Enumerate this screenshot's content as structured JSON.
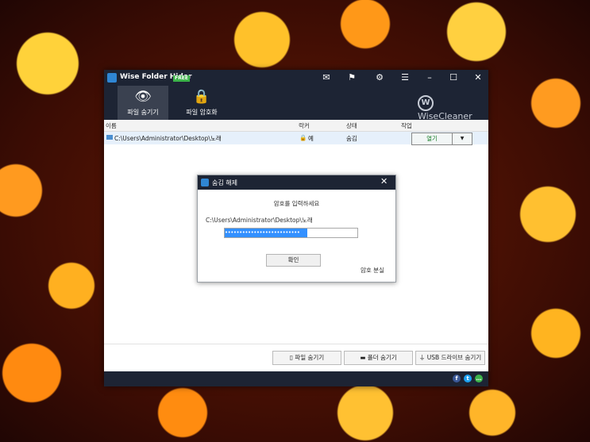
{
  "app": {
    "title": "Wise Folder Hider",
    "badge": "FREE",
    "brand": "WiseCleaner"
  },
  "titlebar_icons": [
    "mail-icon",
    "feedback-icon",
    "settings-icon",
    "menu-icon",
    "minimize-icon",
    "maximize-icon",
    "close-icon"
  ],
  "titlebar_glyphs": {
    "mail": "✉",
    "feedback": "⚑",
    "settings": "⚙",
    "menu": "☰",
    "minimize": "–",
    "maximize": "☐",
    "close": "✕"
  },
  "toolbar": {
    "tabs": [
      {
        "label": "파일 숨기기",
        "icon": "eye-icon",
        "glyph": "👁",
        "active": true
      },
      {
        "label": "파일 암호화",
        "icon": "lock-icon",
        "glyph": "🔒",
        "active": false
      }
    ]
  },
  "table": {
    "columns": [
      "이름",
      "락커",
      "상태",
      "작업"
    ],
    "rows": [
      {
        "name": "C:\\Users\\Administrator\\Desktop\\노래",
        "locker": "예",
        "status": "숨김",
        "action": "열기",
        "dropdown": "▼"
      }
    ]
  },
  "bottom_buttons": [
    "파일 숨기기",
    "폴더 숨기기",
    "USB 드라이브 숨기기"
  ],
  "dialog": {
    "title": "숨김 해제",
    "prompt": "암호를 입력하세요",
    "path": "C:\\Users\\Administrator\\Desktop\\노래",
    "password_mask": "••••••••••••••••••••••••••",
    "ok_label": "확인",
    "lost_password_label": "암호 분실",
    "close_glyph": "✕"
  },
  "colors": {
    "dark_bar": "#1d2434",
    "selection": "#3390ff",
    "facebook": "#3b5998",
    "twitter": "#1da1f2",
    "chat": "#3cb34a"
  }
}
